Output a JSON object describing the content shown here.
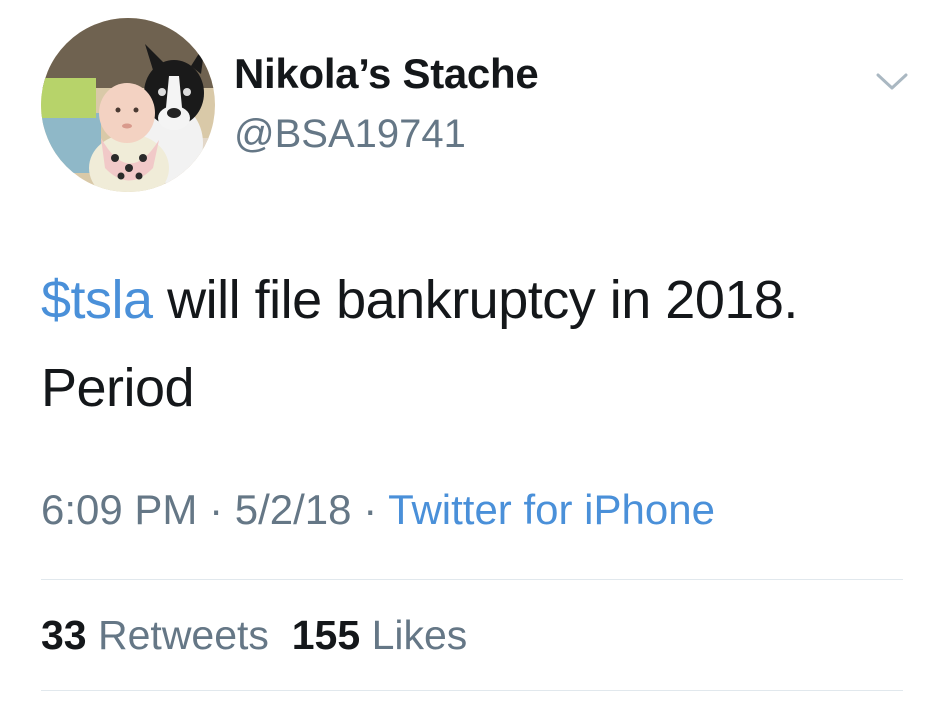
{
  "author": {
    "display_name": "Nikola’s Stache",
    "handle": "@BSA19741"
  },
  "tweet": {
    "cashtag": "$tsla",
    "text_rest": " will file bankruptcy in 2018. Period"
  },
  "meta": {
    "time": "6:09 PM",
    "separator": " · ",
    "date": "5/2/18",
    "source": "Twitter for iPhone"
  },
  "stats": {
    "retweets_count": "33",
    "retweets_label": "Retweets",
    "likes_count": "155",
    "likes_label": "Likes"
  },
  "icons": {
    "menu": "chevron-down-icon"
  },
  "colors": {
    "link": "#4a90d9",
    "secondary_text": "#657786",
    "primary_text": "#14171a",
    "divider": "#e1e8ed"
  }
}
